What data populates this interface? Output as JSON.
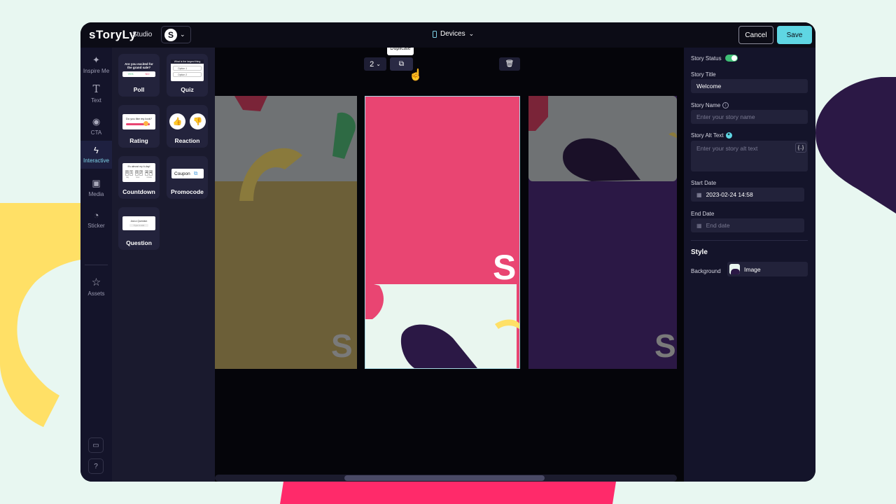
{
  "colors": {
    "background": "#e8f7f1",
    "accent": "#5fd6e3",
    "toggle_on": "#3fbf76",
    "slide_pink": "#e94572",
    "slide_yellow": "#6c5f38",
    "slide_purple": "#2b1845"
  },
  "topbar": {
    "logo": "sToryLy",
    "studio": "Studio",
    "account_initial": "S",
    "devices_label": "Devices",
    "cancel": "Cancel",
    "save": "Save"
  },
  "leftnav": {
    "items": [
      {
        "icon": "sparkle-icon",
        "label": "Inspire Me"
      },
      {
        "icon": "text-icon",
        "label": "Text"
      },
      {
        "icon": "cta-icon",
        "label": "CTA"
      },
      {
        "icon": "bolt-icon",
        "label": "Interactive",
        "active": true
      },
      {
        "icon": "image-icon",
        "label": "Media"
      },
      {
        "icon": "sticker-icon",
        "label": "Sticker"
      },
      {
        "icon": "star-icon",
        "label": "Assets"
      }
    ]
  },
  "panel": {
    "cards": [
      {
        "label": "Poll",
        "thumb_text": "Are you excited for the grand sale?",
        "opt_a": "YES",
        "opt_b": "NO"
      },
      {
        "label": "Quiz",
        "thumb_text": "What is the largest thing",
        "opt_a": "Option 1",
        "opt_b": "Option 2"
      },
      {
        "label": "Rating",
        "thumb_text": "Do you like my look?"
      },
      {
        "label": "Reaction"
      },
      {
        "label": "Countdown",
        "thumb_text": "It's almost my b-day!",
        "digits": [
          "0",
          "1",
          "0",
          "2",
          "4",
          "4"
        ],
        "units": [
          "day",
          "hour",
          "minute"
        ]
      },
      {
        "label": "Promocode",
        "thumb_text": "Coupon"
      },
      {
        "label": "Question",
        "thumb_text": "Ask a Question",
        "sub": "Type to ask"
      }
    ]
  },
  "canvas": {
    "page_number": "2",
    "tooltip": "Duplicate",
    "slide_mark": "S"
  },
  "rpanel": {
    "status_label": "Story Status",
    "status_on": true,
    "title_label": "Story Title",
    "title_value": "Welcome",
    "name_label": "Story Name",
    "name_placeholder": "Enter your story name",
    "alt_label": "Story Alt Text",
    "alt_placeholder": "Enter your story alt text",
    "alt_btn": "{..}",
    "start_label": "Start Date",
    "start_value": "2023-02-24 14:58",
    "end_label": "End Date",
    "end_placeholder": "End date",
    "style_heading": "Style",
    "background_label": "Background",
    "background_value": "Image"
  }
}
